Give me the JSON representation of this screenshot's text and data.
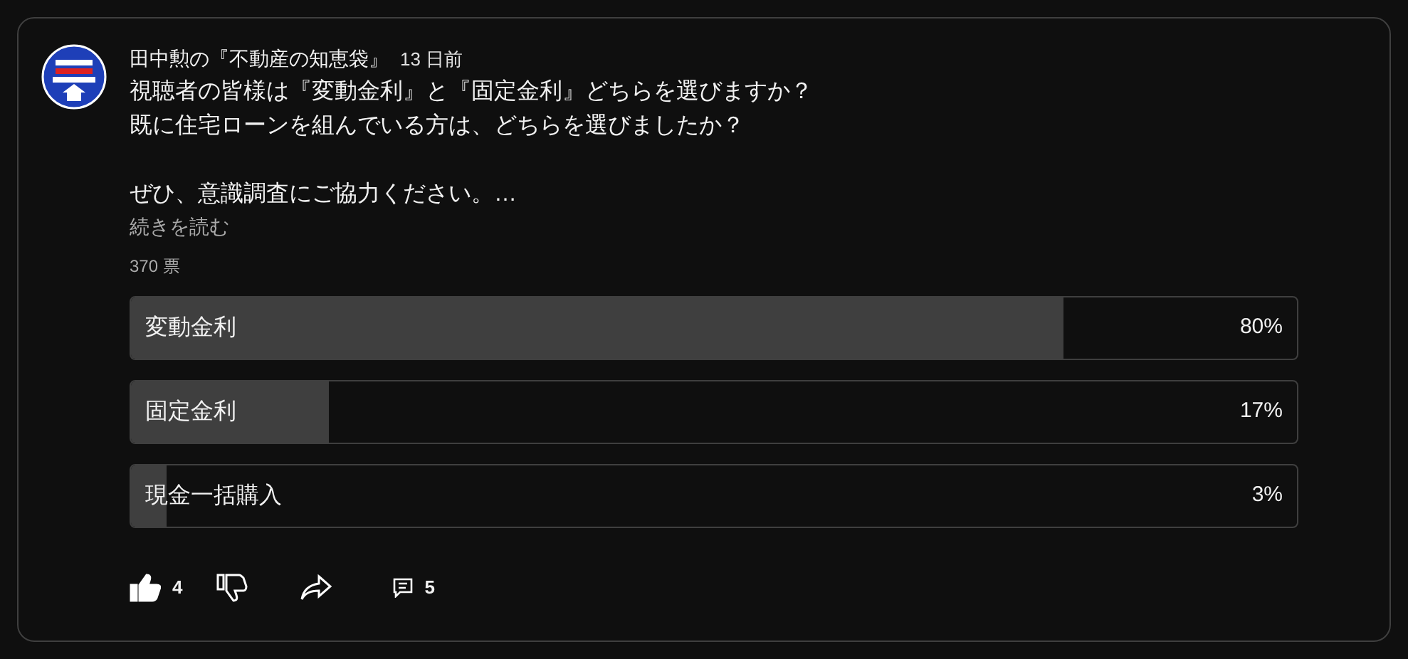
{
  "post": {
    "author": "田中勲の『不動産の知恵袋』",
    "time": "13 日前",
    "body_paragraphs": [
      [
        "視聴者の皆様は『変動金利』と『固定金利』どちらを選びますか？",
        "既に住宅ローンを組んでいる方は、どちらを選びましたか？"
      ],
      [
        "ぜひ、意識調査にご協力ください。…"
      ]
    ],
    "read_more": "続きを読む",
    "votes": "370 票"
  },
  "options": [
    {
      "label": "変動金利",
      "percent": "80%",
      "level": 0.8
    },
    {
      "label": "固定金利",
      "percent": "17%",
      "level": 0.17
    },
    {
      "label": "現金一括購入",
      "percent": "3%",
      "level": 0.03
    }
  ],
  "actions": {
    "liked": true,
    "like_count": "4",
    "comment_count": "5"
  }
}
